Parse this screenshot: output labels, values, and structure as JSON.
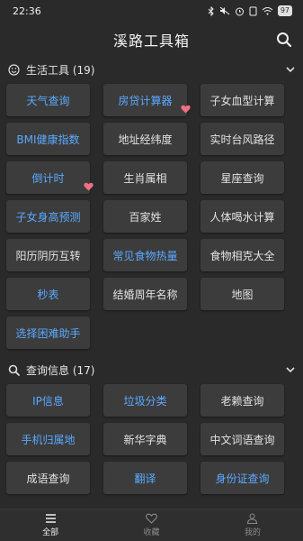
{
  "status_bar": {
    "time": "22:36",
    "battery": "97"
  },
  "app": {
    "title": "溪路工具箱"
  },
  "sections": [
    {
      "title": "生活工具 (19)",
      "tools": [
        {
          "label": "天气查询",
          "highlight": true,
          "favorite": false
        },
        {
          "label": "房贷计算器",
          "highlight": true,
          "favorite": true
        },
        {
          "label": "子女血型计算",
          "highlight": false,
          "favorite": false
        },
        {
          "label": "BMI健康指数",
          "highlight": true,
          "favorite": false
        },
        {
          "label": "地址经纬度",
          "highlight": false,
          "favorite": false
        },
        {
          "label": "实时台风路径",
          "highlight": false,
          "favorite": false
        },
        {
          "label": "倒计时",
          "highlight": true,
          "favorite": true
        },
        {
          "label": "生肖属相",
          "highlight": false,
          "favorite": false
        },
        {
          "label": "星座查询",
          "highlight": false,
          "favorite": false
        },
        {
          "label": "子女身高预测",
          "highlight": true,
          "favorite": false
        },
        {
          "label": "百家姓",
          "highlight": false,
          "favorite": false
        },
        {
          "label": "人体喝水计算",
          "highlight": false,
          "favorite": false
        },
        {
          "label": "阳历阴历互转",
          "highlight": false,
          "favorite": false
        },
        {
          "label": "常见食物热量",
          "highlight": true,
          "favorite": false
        },
        {
          "label": "食物相克大全",
          "highlight": false,
          "favorite": false
        },
        {
          "label": "秒表",
          "highlight": true,
          "favorite": false
        },
        {
          "label": "结婚周年名称",
          "highlight": false,
          "favorite": false
        },
        {
          "label": "地图",
          "highlight": false,
          "favorite": false
        },
        {
          "label": "选择困难助手",
          "highlight": true,
          "favorite": false
        }
      ]
    },
    {
      "title": "查询信息 (17)",
      "tools": [
        {
          "label": "IP信息",
          "highlight": true,
          "favorite": false
        },
        {
          "label": "垃圾分类",
          "highlight": true,
          "favorite": false
        },
        {
          "label": "老赖查询",
          "highlight": false,
          "favorite": false
        },
        {
          "label": "手机归属地",
          "highlight": true,
          "favorite": false
        },
        {
          "label": "新华字典",
          "highlight": false,
          "favorite": false
        },
        {
          "label": "中文词语查询",
          "highlight": false,
          "favorite": false
        },
        {
          "label": "成语查询",
          "highlight": false,
          "favorite": false
        },
        {
          "label": "翻译",
          "highlight": true,
          "favorite": false
        },
        {
          "label": "身份证查询",
          "highlight": true,
          "favorite": false
        }
      ]
    }
  ],
  "bottom_nav": [
    {
      "label": "全部",
      "active": true
    },
    {
      "label": "收藏",
      "active": false
    },
    {
      "label": "我的",
      "active": false
    }
  ],
  "colors": {
    "accent_blue": "#5aa9ff",
    "favorite_red": "#f07080",
    "background": "#2a2a2a",
    "tile": "#3c3c3c"
  }
}
